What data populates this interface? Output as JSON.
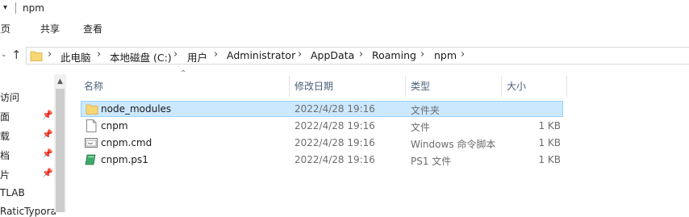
{
  "window": {
    "title": "npm"
  },
  "ribbon": {
    "tabs": [
      "主页",
      "共享",
      "查看"
    ]
  },
  "address_bar": {
    "crumbs": [
      "此电脑",
      "本地磁盘 (C:)",
      "用户",
      "Administrator",
      "AppData",
      "Roaming",
      "npm"
    ]
  },
  "nav_pane": {
    "items": [
      "访问",
      "面",
      "载",
      "档",
      "片",
      "TLAB",
      "RaticTypora"
    ]
  },
  "columns": {
    "name": "名称",
    "date": "修改日期",
    "type": "类型",
    "size": "大小"
  },
  "files": [
    {
      "name": "node_modules",
      "date": "2022/4/28 19:16",
      "type": "文件夹",
      "size": "",
      "icon": "folder-icon",
      "selected": true
    },
    {
      "name": "cnpm",
      "date": "2022/4/28 19:16",
      "type": "文件",
      "size": "1 KB",
      "icon": "file-icon"
    },
    {
      "name": "cnpm.cmd",
      "date": "2022/4/28 19:16",
      "type": "Windows 命令脚本",
      "size": "1 KB",
      "icon": "cmd-script-icon"
    },
    {
      "name": "cnpm.ps1",
      "date": "2022/4/28 19:16",
      "type": "PS1 文件",
      "size": "1 KB",
      "icon": "ps1-script-icon"
    }
  ],
  "colors": {
    "selection_bg": "#cce8ff",
    "selection_border": "#99d1ff",
    "folder": "#f8d775"
  }
}
